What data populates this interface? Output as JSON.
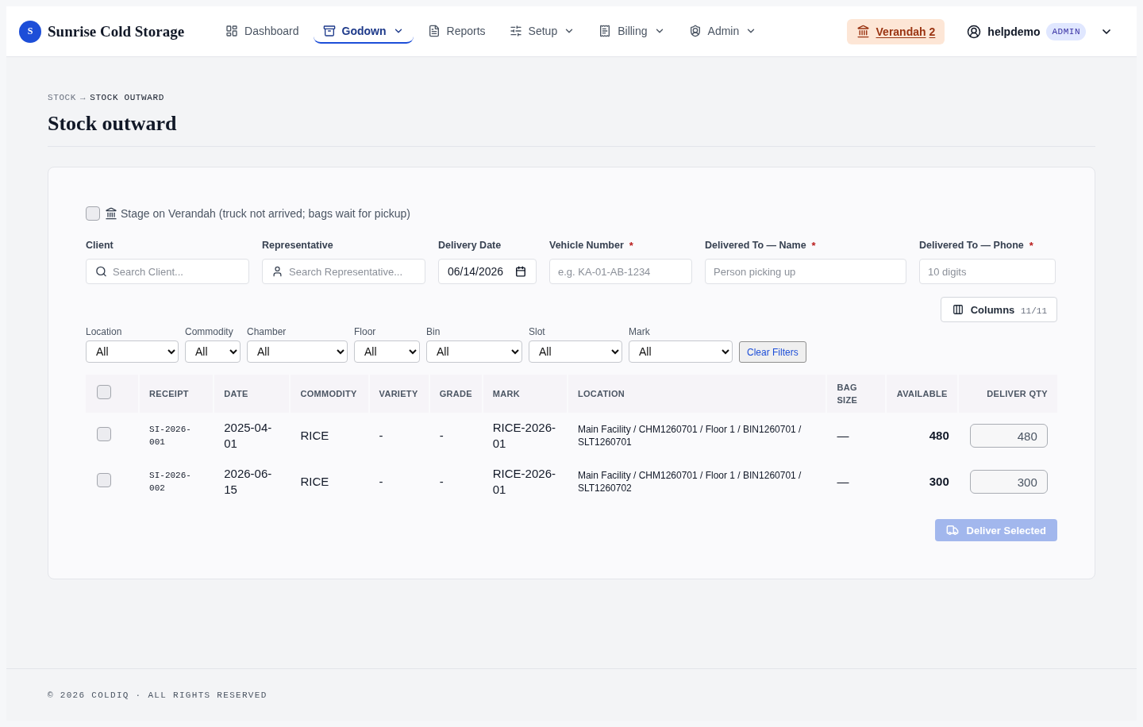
{
  "brand": {
    "logo_letter": "S",
    "name": "Sunrise Cold Storage"
  },
  "nav": [
    {
      "label": "Dashboard",
      "selected": false,
      "has_menu": false
    },
    {
      "label": "Godown",
      "selected": true,
      "has_menu": true
    },
    {
      "label": "Reports",
      "selected": false,
      "has_menu": false
    },
    {
      "label": "Setup",
      "selected": false,
      "has_menu": true
    },
    {
      "label": "Billing",
      "selected": false,
      "has_menu": true
    },
    {
      "label": "Admin",
      "selected": false,
      "has_menu": true
    }
  ],
  "verandah": {
    "label": "Verandah",
    "count": "2"
  },
  "user": {
    "name": "helpdemo",
    "role": "ADMIN"
  },
  "breadcrumb": {
    "separator": "→",
    "items": [
      {
        "label": "STOCK",
        "current": false
      },
      {
        "label": "STOCK OUTWARD",
        "current": true
      }
    ]
  },
  "title": "Stock outward",
  "stage_option": {
    "label": "Stage on Verandah (truck not arrived; bags wait for pickup)",
    "checked": false
  },
  "fields": [
    {
      "kind": "search",
      "label": "Client",
      "placeholder": "Search Client..."
    },
    {
      "kind": "person",
      "label": "Representative",
      "placeholder": "Search Representative..."
    },
    {
      "kind": "date",
      "label": "Delivery Date",
      "value": "06/14/2026"
    },
    {
      "kind": "text",
      "label": "Vehicle Number",
      "required_mark": "*",
      "placeholder": "e.g. KA-01-AB-1234"
    },
    {
      "kind": "text",
      "label": "Delivered To — Name",
      "required_mark": "*",
      "placeholder": "Person picking up"
    },
    {
      "kind": "text",
      "label": "Delivered To — Phone",
      "required_mark": "*",
      "placeholder": "10 digits"
    }
  ],
  "columns_button": {
    "label": "Columns",
    "count": "11/11"
  },
  "filters": [
    {
      "label": "Location",
      "value": "All"
    },
    {
      "label": "Commodity",
      "value": "All"
    },
    {
      "label": "Chamber",
      "value": "All"
    },
    {
      "label": "Floor",
      "value": "All"
    },
    {
      "label": "Bin",
      "value": "All"
    },
    {
      "label": "Slot",
      "value": "All"
    },
    {
      "label": "Mark",
      "value": "All"
    }
  ],
  "clear_filters": "Clear Filters",
  "table": {
    "select_all_checked": false,
    "columns": [
      "RECEIPT",
      "DATE",
      "COMMODITY",
      "VARIETY",
      "GRADE",
      "MARK",
      "LOCATION",
      "BAG SIZE",
      "AVAILABLE",
      "DELIVER QTY"
    ],
    "rows": [
      {
        "selected": false,
        "cells": [
          "SI-2026-001",
          "2025-04-01",
          "RICE",
          "-",
          "-",
          "RICE-2026-01",
          "Main Facility / CHM1260701 / Floor 1 / BIN1260701 / SLT1260701",
          "—",
          "480"
        ],
        "deliver_qty": "480"
      },
      {
        "selected": false,
        "cells": [
          "SI-2026-002",
          "2026-06-15",
          "RICE",
          "-",
          "-",
          "RICE-2026-01",
          "Main Facility / CHM1260701 / Floor 1 / BIN1260701 / SLT1260702",
          "—",
          "300"
        ],
        "deliver_qty": "300"
      }
    ]
  },
  "deliver_button": {
    "label": "Deliver Selected",
    "disabled": true
  },
  "footer": "© 2026 COLDIQ · ALL RIGHTS RESERVED"
}
